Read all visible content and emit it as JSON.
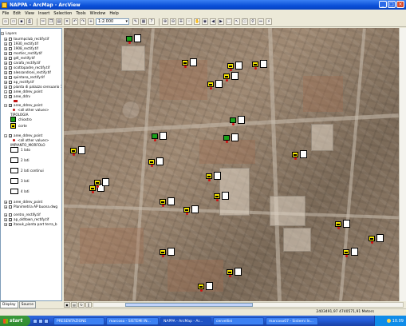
{
  "window": {
    "title": "NAPPA - ArcMap - ArcView"
  },
  "menu": [
    "File",
    "Edit",
    "View",
    "Insert",
    "Selection",
    "Tools",
    "Window",
    "Help"
  ],
  "toolbar": {
    "scale": "1:2.000"
  },
  "toc": {
    "root": "Layers",
    "layers": [
      {
        "label": "tourmpclub_rectify.tif",
        "checked": false
      },
      {
        "label": "1930_rectify.tif",
        "checked": false
      },
      {
        "label": "1908_rectify.tif",
        "checked": false
      },
      {
        "label": "mortier_rectify.tif",
        "checked": false
      },
      {
        "label": "gdl_rectify.tif",
        "checked": false
      },
      {
        "label": "carafa_rectify.tif",
        "checked": false
      },
      {
        "label": "scottopadre_rectify.tif",
        "checked": false
      },
      {
        "label": "alessandroni_rectify.tif",
        "checked": false
      },
      {
        "label": "quintana_rectify.tif",
        "checked": false
      },
      {
        "label": "ap_rectify.tif",
        "checked": false
      },
      {
        "label": "pianta di palazzo censuario 1e",
        "checked": false
      },
      {
        "label": "aree_ddrev_point",
        "checked": true
      },
      {
        "label": "aree_ddrv",
        "checked": true
      },
      {
        "label": "aree_ddrev_point",
        "checked": true
      },
      {
        "label": "<all other values>",
        "checked": null
      },
      {
        "label": "TIPOLOGIA",
        "checked": null
      },
      {
        "label": "chiostro",
        "checked": null
      },
      {
        "label": "corte",
        "checked": null
      },
      {
        "label": "aree_ddrev_point",
        "checked": true
      },
      {
        "label": "<all other values>",
        "checked": null
      },
      {
        "label": "IMPIANTO_MORFOLO",
        "checked": null
      },
      {
        "label": "1 lato",
        "checked": null
      },
      {
        "label": "2 lati",
        "checked": null
      },
      {
        "label": "2 lati continui",
        "checked": null
      },
      {
        "label": "3 lati",
        "checked": null
      },
      {
        "label": "4 lati",
        "checked": null
      },
      {
        "label": "aree_ddrev_point",
        "checked": false
      },
      {
        "label": "Planimetria AP buona.dwg",
        "checked": false
      },
      {
        "label": "centro_rectify.tif",
        "checked": false
      },
      {
        "label": "ap_oldtown_rectify.tif",
        "checked": true
      },
      {
        "label": "itaouk_pianta part terra_b",
        "checked": true
      }
    ],
    "tabs": [
      "Display",
      "Source"
    ]
  },
  "status": {
    "coordinates": "2403491,97  4740571,91 Meters"
  },
  "taskbar": {
    "start": "start",
    "buttons": [
      "PRESENTAZIONE",
      "marcoso - SISTEMI IN...",
      "NAPPA - ArcMap - Ar...",
      "cervellini",
      "marcoso07 - Sistemi In..."
    ],
    "clock": "10.09"
  }
}
